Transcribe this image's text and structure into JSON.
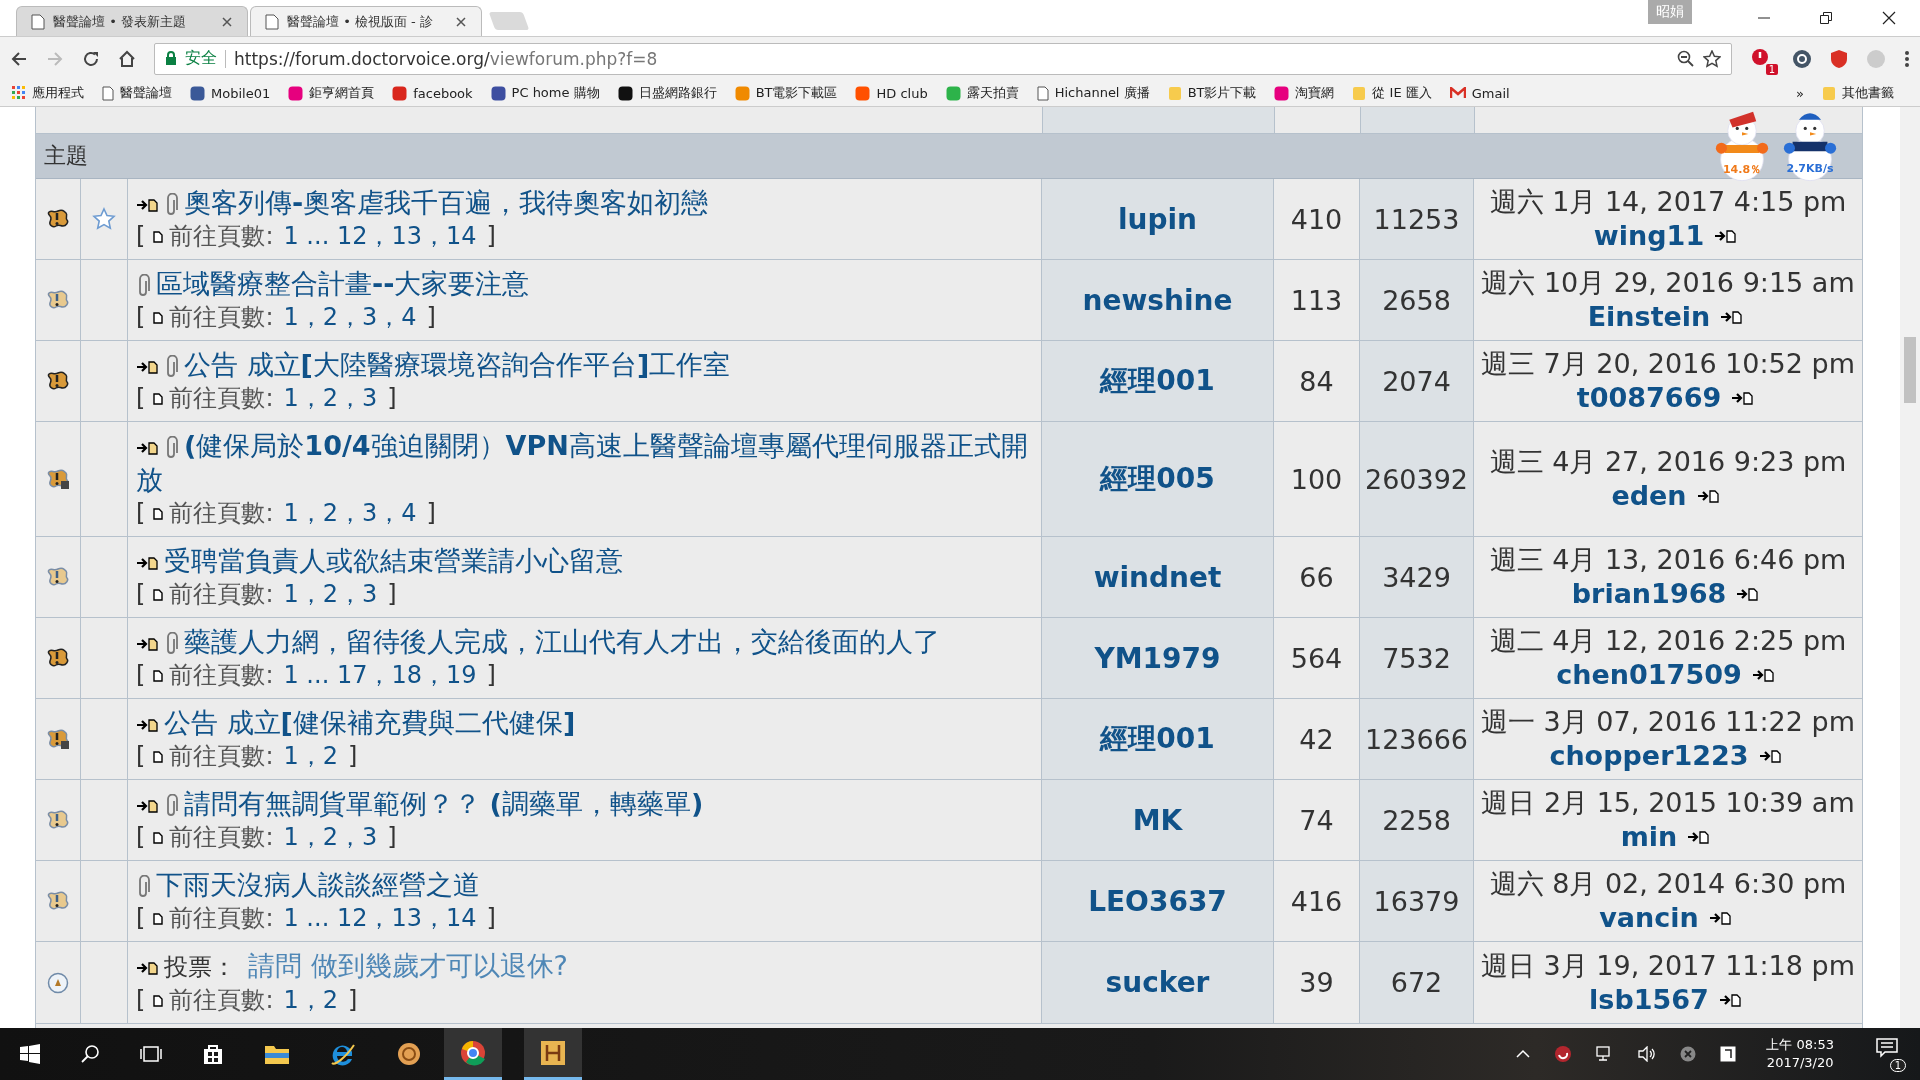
{
  "browser": {
    "tabs": [
      {
        "title": "醫聲論壇 • 發表新主題",
        "selected": false
      },
      {
        "title": "醫聲論壇 • 檢視版面 - 診",
        "selected": true
      }
    ],
    "profile": "昭娟",
    "security": "安全",
    "url_host": "https://forum.doctorvoice.org/",
    "url_path": "viewforum.php?f=8",
    "extension_badge": "1",
    "bookmarks": [
      {
        "label": "應用程式",
        "kind": "apps"
      },
      {
        "label": "醫聲論壇",
        "kind": "page"
      },
      {
        "label": "Mobile01",
        "kind": "logo"
      },
      {
        "label": "鉅亨網首頁",
        "kind": "logo"
      },
      {
        "label": "facebook",
        "kind": "logo"
      },
      {
        "label": "PC home 購物",
        "kind": "logo"
      },
      {
        "label": "日盛網路銀行",
        "kind": "logo"
      },
      {
        "label": "BT電影下載區",
        "kind": "logo"
      },
      {
        "label": "HD club",
        "kind": "logo"
      },
      {
        "label": "露天拍賣",
        "kind": "logo"
      },
      {
        "label": "Hichannel 廣播",
        "kind": "page"
      },
      {
        "label": "BT影片下載",
        "kind": "folder"
      },
      {
        "label": "淘寶網",
        "kind": "logo"
      },
      {
        "label": "從 IE 匯入",
        "kind": "folder"
      },
      {
        "label": "Gmail",
        "kind": "mail"
      }
    ],
    "bookmarks_more": "»",
    "other_bookmarks": "其他書籤"
  },
  "forum": {
    "header": "主題",
    "rows": [
      {
        "kind": "hot",
        "starred": true,
        "new_post": true,
        "attachment": true,
        "title": "奧客列傳**-**奧客虐我千百遍，我待奧客如初戀",
        "pages_open": "[",
        "pages_label": "前往頁數:",
        "pages": "1 ... 12，13，14",
        "pages_close": "]",
        "author": "lupin",
        "replies": "410",
        "views": "11253",
        "last_date": "週六 1月 14, 2017 4:15 pm",
        "last_user": "wing11"
      },
      {
        "kind": "normal",
        "starred": false,
        "new_post": false,
        "attachment": true,
        "title": "區域醫療整合計畫**--**大家要注意",
        "pages_open": "[",
        "pages_label": "前往頁數:",
        "pages": "1，2，3，4",
        "pages_close": "]",
        "author": "newshine",
        "replies": "113",
        "views": "2658",
        "last_date": "週六 10月 29, 2016 9:15 am",
        "last_user": "Einstein"
      },
      {
        "kind": "hot",
        "starred": false,
        "new_post": true,
        "attachment": true,
        "title": "公告 成立**[**大陸醫療環境咨詢合作平台**]**工作室",
        "pages_open": "[",
        "pages_label": "前往頁數:",
        "pages": "1，2，3",
        "pages_close": "]",
        "author": "經理001",
        "replies": "84",
        "views": "2074",
        "last_date": "週三 7月 20, 2016 10:52 pm",
        "last_user": "t0087669"
      },
      {
        "kind": "locked",
        "starred": false,
        "new_post": true,
        "attachment": true,
        "title": "**(**健保局於**10/4**強迫關閉）**VPN**高速上醫聲論壇專屬代理伺服器正式開放",
        "pages_open": "[",
        "pages_label": "前往頁數:",
        "pages": "1，2，3，4",
        "pages_close": "]",
        "author": "經理005",
        "replies": "100",
        "views": "260392",
        "last_date": "週三 4月 27, 2016 9:23 pm",
        "last_user": "eden"
      },
      {
        "kind": "normal",
        "starred": false,
        "new_post": true,
        "attachment": false,
        "title": "受聘當負責人或欲結束營業請小心留意",
        "pages_open": "[",
        "pages_label": "前往頁數:",
        "pages": "1，2，3",
        "pages_close": "]",
        "author": "windnet",
        "replies": "66",
        "views": "3429",
        "last_date": "週三 4月 13, 2016 6:46 pm",
        "last_user": "brian1968"
      },
      {
        "kind": "hot",
        "starred": false,
        "new_post": true,
        "attachment": true,
        "title": "藥護人力網，留待後人完成，江山代有人才出，交給後面的人了",
        "pages_open": "[",
        "pages_label": "前往頁數:",
        "pages": "1 ... 17，18，19",
        "pages_close": "]",
        "author": "YM1979",
        "replies": "564",
        "views": "7532",
        "last_date": "週二 4月 12, 2016 2:25 pm",
        "last_user": "chen017509"
      },
      {
        "kind": "locked",
        "starred": false,
        "new_post": true,
        "attachment": false,
        "title": "公告 成立**[**健保補充費與二代健保**]**",
        "pages_open": "[",
        "pages_label": "前往頁數:",
        "pages": "1，2",
        "pages_close": "]",
        "author": "經理001",
        "replies": "42",
        "views": "123666",
        "last_date": "週一 3月 07, 2016 11:22 pm",
        "last_user": "chopper1223"
      },
      {
        "kind": "normal",
        "starred": false,
        "new_post": true,
        "attachment": true,
        "title": "請問有無調貨單範例？？ **(**調藥單，轉藥單**)**",
        "pages_open": "[",
        "pages_label": "前往頁數:",
        "pages": "1，2，3",
        "pages_close": "]",
        "author": "MK",
        "replies": "74",
        "views": "2258",
        "last_date": "週日 2月 15, 2015 10:39 am",
        "last_user": "min"
      },
      {
        "kind": "normal",
        "starred": false,
        "new_post": false,
        "attachment": true,
        "title": "下雨天沒病人談談經營之道",
        "pages_open": "[",
        "pages_label": "前往頁數:",
        "pages": "1 ... 12，13，14",
        "pages_close": "]",
        "author": "LEO3637",
        "replies": "416",
        "views": "16379",
        "last_date": "週六 8月 02, 2014 6:30 pm",
        "last_user": "vancin"
      },
      {
        "kind": "poll",
        "starred": false,
        "new_post": true,
        "attachment": false,
        "prefix": "投票：",
        "title": "請問 做到幾歲才可以退休?",
        "pages_open": "[",
        "pages_label": "前往頁數:",
        "pages": "1，2",
        "pages_close": "]",
        "author": "sucker",
        "replies": "39",
        "views": "672",
        "last_date": "週日 3月 19, 2017 11:18 pm",
        "last_user": "lsb1567"
      }
    ]
  },
  "widgets": {
    "cpu": "14.8％",
    "network": "2.7KB/s"
  },
  "taskbar": {
    "time": "上午 08:53",
    "date": "2017/3/20",
    "notifications": "1"
  }
}
